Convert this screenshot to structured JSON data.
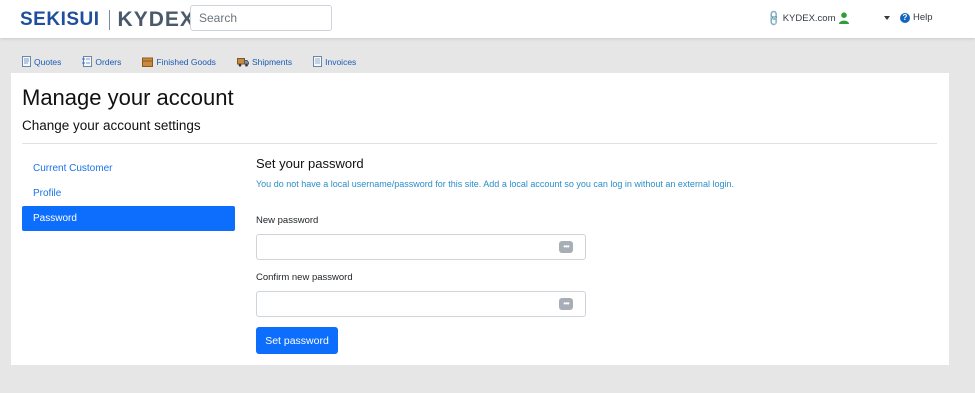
{
  "header": {
    "logo_left": "SEKISUI",
    "logo_right": "KYDEX",
    "search": {
      "placeholder": "Search",
      "value": ""
    },
    "site_link": "KYDEX.com",
    "help_label": "Help",
    "icons": {
      "site_link": "link-icon",
      "user": "user-icon",
      "help": "question-circle-icon",
      "menu": "caret-down-icon"
    },
    "colors": {
      "logo_blue": "#1f4e9c",
      "logo_gray": "#4a5a6a"
    }
  },
  "modules": [
    {
      "label": "Quotes",
      "icon": "document-icon"
    },
    {
      "label": "Orders",
      "icon": "document-list-icon"
    },
    {
      "label": "Finished Goods",
      "icon": "box-icon"
    },
    {
      "label": "Shipments",
      "icon": "truck-icon"
    },
    {
      "label": "Invoices",
      "icon": "invoice-icon"
    }
  ],
  "page": {
    "title": "Manage your account",
    "subtitle": "Change your account settings"
  },
  "side_nav": {
    "items": [
      {
        "label": "Current Customer",
        "active": false
      },
      {
        "label": "Profile",
        "active": false
      },
      {
        "label": "Password",
        "active": true
      }
    ]
  },
  "form": {
    "title": "Set your password",
    "info": "You do not have a local username/password for this site. Add a local account so you can log in without an external login.",
    "new_password_label": "New password",
    "new_password_value": "",
    "confirm_password_label": "Confirm new password",
    "confirm_password_value": "",
    "submit_label": "Set password"
  },
  "colors": {
    "primary": "#0d6efd",
    "link": "#1a73e8",
    "info_text": "#2a8ec9",
    "page_background": "#e6e6e6"
  }
}
